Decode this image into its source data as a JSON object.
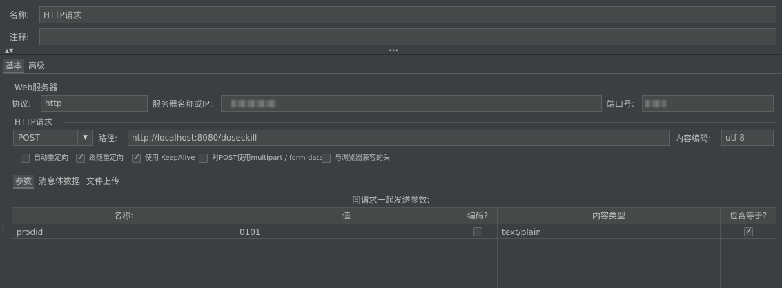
{
  "header": {
    "name_label": "名称:",
    "name_value": "HTTP请求",
    "comment_label": "注释:",
    "comment_value": ""
  },
  "splitter": {
    "arrows": "▲▼",
    "grip": "•••"
  },
  "main_tabs": [
    {
      "label": "基本",
      "selected": true
    },
    {
      "label": "高级",
      "selected": false
    }
  ],
  "web_server": {
    "section_title": "Web服务器",
    "protocol_label": "协议:",
    "protocol_value": "http",
    "server_label": "服务器名称或IP:",
    "port_label": "端口号:"
  },
  "http_request": {
    "section_title": "HTTP请求",
    "method_value": "POST",
    "path_label": "路径:",
    "path_value": "http://localhost:8080/doseckill",
    "encoding_label": "内容编码:",
    "encoding_value": "utf-8"
  },
  "options": [
    {
      "label": "自动重定向",
      "checked": false
    },
    {
      "label": "跟随重定向",
      "checked": true
    },
    {
      "label": "使用 KeepAlive",
      "checked": true
    },
    {
      "label": "对POST使用multipart / form-data",
      "checked": false
    },
    {
      "label": "与浏览器兼容的头",
      "checked": false
    }
  ],
  "sub_tabs": [
    {
      "label": "参数",
      "selected": true
    },
    {
      "label": "消息体数据",
      "selected": false
    },
    {
      "label": "文件上传",
      "selected": false
    }
  ],
  "params_table": {
    "caption": "同请求一起发送参数:",
    "columns": [
      "名称:",
      "值",
      "编码?",
      "内容类型",
      "包含等于?"
    ],
    "rows": [
      {
        "name": "prodid",
        "value": "0101",
        "encode": false,
        "content_type": "text/plain",
        "include_equals": true
      }
    ]
  }
}
